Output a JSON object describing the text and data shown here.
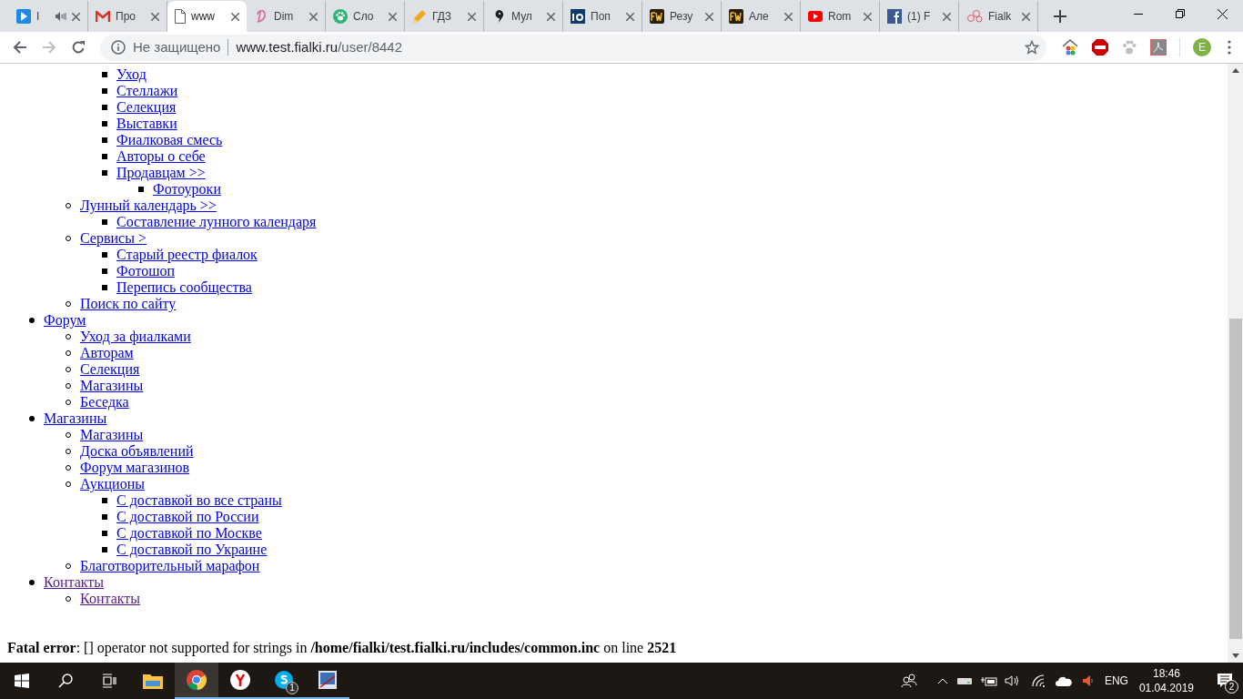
{
  "browser": {
    "tabs": [
      {
        "title": "I",
        "kind": "play",
        "audio": true,
        "selected": false
      },
      {
        "title": "Про",
        "kind": "gmail",
        "audio": false,
        "selected": false
      },
      {
        "title": "www",
        "kind": "page",
        "audio": false,
        "selected": true
      },
      {
        "title": "Dim",
        "kind": "script",
        "audio": false,
        "selected": false
      },
      {
        "title": "Сло",
        "kind": "paw",
        "audio": false,
        "selected": false
      },
      {
        "title": "ГДЗ",
        "kind": "pencil",
        "audio": false,
        "selected": false
      },
      {
        "title": "Мул",
        "kind": "bird",
        "audio": false,
        "selected": false
      },
      {
        "title": "Поп",
        "kind": "io",
        "audio": false,
        "selected": false
      },
      {
        "title": "Резу",
        "kind": "fw",
        "audio": false,
        "selected": false
      },
      {
        "title": "Але",
        "kind": "fw",
        "audio": false,
        "selected": false
      },
      {
        "title": "Rom",
        "kind": "youtube",
        "audio": false,
        "selected": false
      },
      {
        "title": "(1) F",
        "kind": "facebook",
        "audio": false,
        "selected": false
      },
      {
        "title": "Fialk",
        "kind": "flowers",
        "audio": false,
        "selected": false
      }
    ],
    "address": {
      "security_label": "Не защищено",
      "host": "www.test.fialki.ru",
      "path": "/user/8442"
    },
    "profile_initial": "E"
  },
  "menu": [
    {
      "children": [
        {
          "children": [
            {
              "label": "Уход",
              "visited": false
            },
            {
              "label": "Стеллажи",
              "visited": false
            },
            {
              "label": "Селекция",
              "visited": false
            },
            {
              "label": "Выставки",
              "visited": false
            },
            {
              "label": "Фиалковая смесь",
              "visited": false
            },
            {
              "label": "Авторы о себе",
              "visited": false
            },
            {
              "label": "Продавцам >>",
              "visited": false,
              "children": [
                {
                  "label": "Фотоуроки",
                  "visited": false
                }
              ]
            }
          ]
        },
        {
          "label": "Лунный календарь >>",
          "visited": false,
          "children": [
            {
              "label": "Составление лунного календаря",
              "visited": false
            }
          ]
        },
        {
          "label": "Сервисы >",
          "visited": false,
          "children": [
            {
              "label": "Старый реестр фиалок",
              "visited": false
            },
            {
              "label": "Фотошоп",
              "visited": false
            },
            {
              "label": "Перепись сообщества",
              "visited": false
            }
          ]
        },
        {
          "label": "Поиск по сайту",
          "visited": false
        }
      ]
    },
    {
      "label": "Форум",
      "visited": false,
      "children": [
        {
          "label": "Уход за фиалками",
          "visited": false
        },
        {
          "label": "Авторам",
          "visited": false
        },
        {
          "label": "Селекция",
          "visited": false
        },
        {
          "label": "Магазины",
          "visited": false
        },
        {
          "label": "Беседка",
          "visited": false
        }
      ]
    },
    {
      "label": "Магазины",
      "visited": false,
      "children": [
        {
          "label": "Магазины",
          "visited": false
        },
        {
          "label": "Доска объявлений",
          "visited": false
        },
        {
          "label": "Форум магазинов",
          "visited": false
        },
        {
          "label": "Аукционы",
          "visited": false,
          "children": [
            {
              "label": "С доставкой во все страны",
              "visited": false
            },
            {
              "label": "С доставкой по России",
              "visited": false
            },
            {
              "label": "С доставкой по Москве",
              "visited": false
            },
            {
              "label": "С доставкой по Украине",
              "visited": false
            }
          ]
        },
        {
          "label": "Благотворительный марафон",
          "visited": false
        }
      ]
    },
    {
      "label": "Контакты",
      "visited": true,
      "children": [
        {
          "label": "Контакты",
          "visited": true
        }
      ]
    }
  ],
  "error": "**Fatal error**: [] operator not supported for strings in **/home/fialki/test.fialki.ru/includes/common.inc** on line **2521**",
  "taskbar": {
    "skype_badge": "1",
    "language": "ENG",
    "time": "18:46",
    "date": "01.04.2019",
    "notification_count": "2"
  }
}
